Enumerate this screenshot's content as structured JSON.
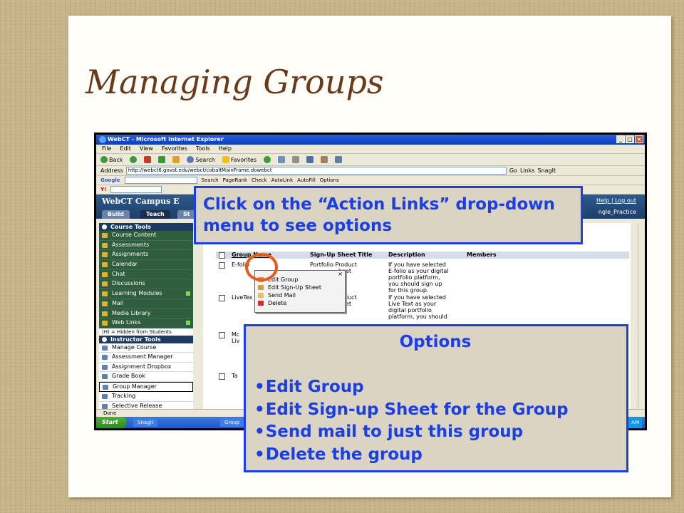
{
  "slide": {
    "title": "Managing Groups"
  },
  "browser": {
    "window_title": "WebCT - Microsoft Internet Explorer",
    "menu": [
      "File",
      "Edit",
      "View",
      "Favorites",
      "Tools",
      "Help"
    ],
    "toolbar": {
      "back": "Back",
      "search": "Search",
      "favorites": "Favorites"
    },
    "address": {
      "label": "Address",
      "url": "http://webct6.govst.edu/webct/cobaltMainFrame.dowebct",
      "go": "Go",
      "links": "Links",
      "snagit": "SnagIt"
    },
    "google": {
      "label": "Google",
      "search": "Search",
      "pagerank": "PageRank",
      "check": "Check",
      "autolink": "AutoLink",
      "autofill": "AutoFill",
      "options": "Options"
    },
    "status": "Done"
  },
  "webct": {
    "logo": "WebCT Campus E",
    "tabs": [
      "Build",
      "Teach",
      "St"
    ],
    "help_links": "Help | Log out",
    "section_name": "ngle_Practice",
    "course_tools": {
      "heading": "Course Tools",
      "items": [
        "Course Content",
        "Assessments",
        "Assignments",
        "Calendar",
        "Chat",
        "Discussions",
        "Learning Modules",
        "Mail",
        "Media Library",
        "Web Links"
      ]
    },
    "hidden_note": "(H) = Hidden from Students",
    "instructor_tools": {
      "heading": "Instructor Tools",
      "items": [
        "Manage Course",
        "Assessment Manager",
        "Assignment Dropbox",
        "Grade Book",
        "Group Manager",
        "Tracking",
        "Selective Release"
      ]
    },
    "grid": {
      "columns": [
        "Group Name",
        "Sign-Up Sheet Title",
        "Description",
        "Members"
      ],
      "rows": [
        {
          "name": "E-folio",
          "sheet": "Portfolio Product",
          "sheet2": "heet",
          "desc": [
            "If you have selected",
            "E-folio as your digital",
            "portfolio platform,",
            "you should sign up",
            "for this group."
          ]
        },
        {
          "name": "LiveTex",
          "sheet": "roduct",
          "sheet2": "heet",
          "desc": [
            "If you have selected",
            "Live Text as your",
            "digital portfolio",
            "platform, you should"
          ]
        },
        {
          "name": "Mc",
          "name2": "Liv"
        },
        {
          "name": "Ta"
        }
      ]
    },
    "action_menu": [
      "Edit Group",
      "Edit Sign-Up Sheet",
      "Send Mail",
      "Delete"
    ]
  },
  "taskbar": {
    "start": "Start",
    "items": [
      "SnagIt",
      "Group"
    ],
    "clock": "AM"
  },
  "callouts": {
    "instruction": "Click on the “Action Links” drop-down menu to see options",
    "options_heading": "Options",
    "options": [
      "Edit Group",
      "Edit Sign-up Sheet for the Group",
      "Send mail to just this group",
      "Delete the group"
    ]
  },
  "colors": {
    "title": "#6a3a1b",
    "callout_text": "#1a3ee8",
    "callout_bg": "#dcd4c2",
    "highlight_circle": "#e85a18"
  }
}
